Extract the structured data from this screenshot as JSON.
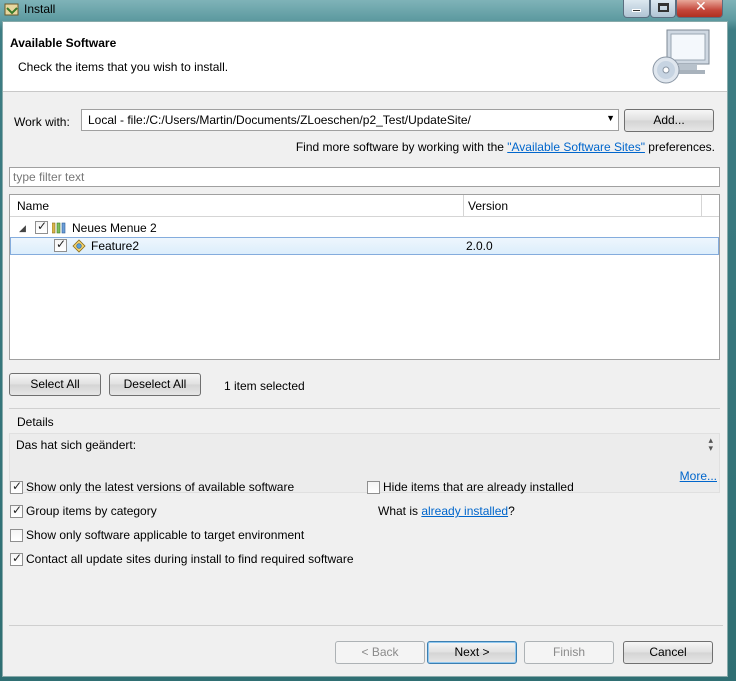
{
  "window": {
    "title": "Install"
  },
  "banner": {
    "title": "Available Software",
    "description": "Check the items that you wish to install."
  },
  "work_with": {
    "label": "Work with:",
    "value": "Local - file:/C:/Users/Martin/Documents/ZLoeschen/p2_Test/UpdateSite/",
    "add_button": "Add...",
    "find_more_prefix": "Find more software by working with the ",
    "find_more_link": "\"Available Software Sites\"",
    "find_more_suffix": " preferences."
  },
  "filter": {
    "placeholder": "type filter text"
  },
  "table": {
    "columns": [
      "Name",
      "Version"
    ],
    "rows": [
      {
        "name": "Neues Menue 2",
        "version": "",
        "checked": true,
        "expanded": true,
        "icon": "category-icon"
      },
      {
        "name": "Feature2",
        "version": "2.0.0",
        "checked": true,
        "selected": true,
        "icon": "feature-icon"
      }
    ]
  },
  "selection": {
    "select_all": "Select All",
    "deselect_all": "Deselect All",
    "status": "1 item selected"
  },
  "details": {
    "label": "Details",
    "text": "Das hat sich geändert:",
    "more_link": "More..."
  },
  "options": {
    "latest_versions": {
      "label": "Show only the latest versions of available software",
      "checked": true
    },
    "hide_installed": {
      "label": "Hide items that are already installed",
      "checked": false
    },
    "group_by_category": {
      "label": "Group items by category",
      "checked": true
    },
    "what_is_prefix": "What is ",
    "what_is_link": "already installed",
    "what_is_suffix": "?",
    "target_env": {
      "label": "Show only software applicable to target environment",
      "checked": false
    },
    "contact_all": {
      "label": "Contact all update sites during install to find required software",
      "checked": true
    }
  },
  "footer": {
    "back": "< Back",
    "next": "Next >",
    "finish": "Finish",
    "cancel": "Cancel"
  },
  "colors": {
    "link": "#0066cc",
    "selection": "#dceefc",
    "selection_border": "#84acdd"
  }
}
